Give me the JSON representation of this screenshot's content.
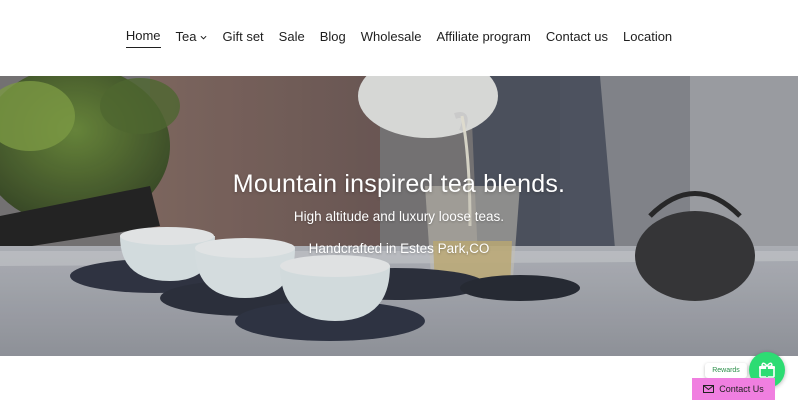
{
  "nav": {
    "items": [
      {
        "label": "Home",
        "active": true
      },
      {
        "label": "Tea",
        "has_dropdown": true
      },
      {
        "label": "Gift set"
      },
      {
        "label": "Sale"
      },
      {
        "label": "Blog"
      },
      {
        "label": "Wholesale"
      },
      {
        "label": "Affiliate program"
      },
      {
        "label": "Contact us"
      },
      {
        "label": "Location"
      }
    ]
  },
  "hero": {
    "title": "Mountain inspired tea blends.",
    "subtitle": "High altitude and luxury loose teas.",
    "tagline": "Handcrafted in Estes Park,CO"
  },
  "widgets": {
    "rewards_label": "Rewards",
    "contact_label": "Contact Us",
    "rewards_color": "#2ddc73",
    "contact_color": "#f07fe0"
  }
}
